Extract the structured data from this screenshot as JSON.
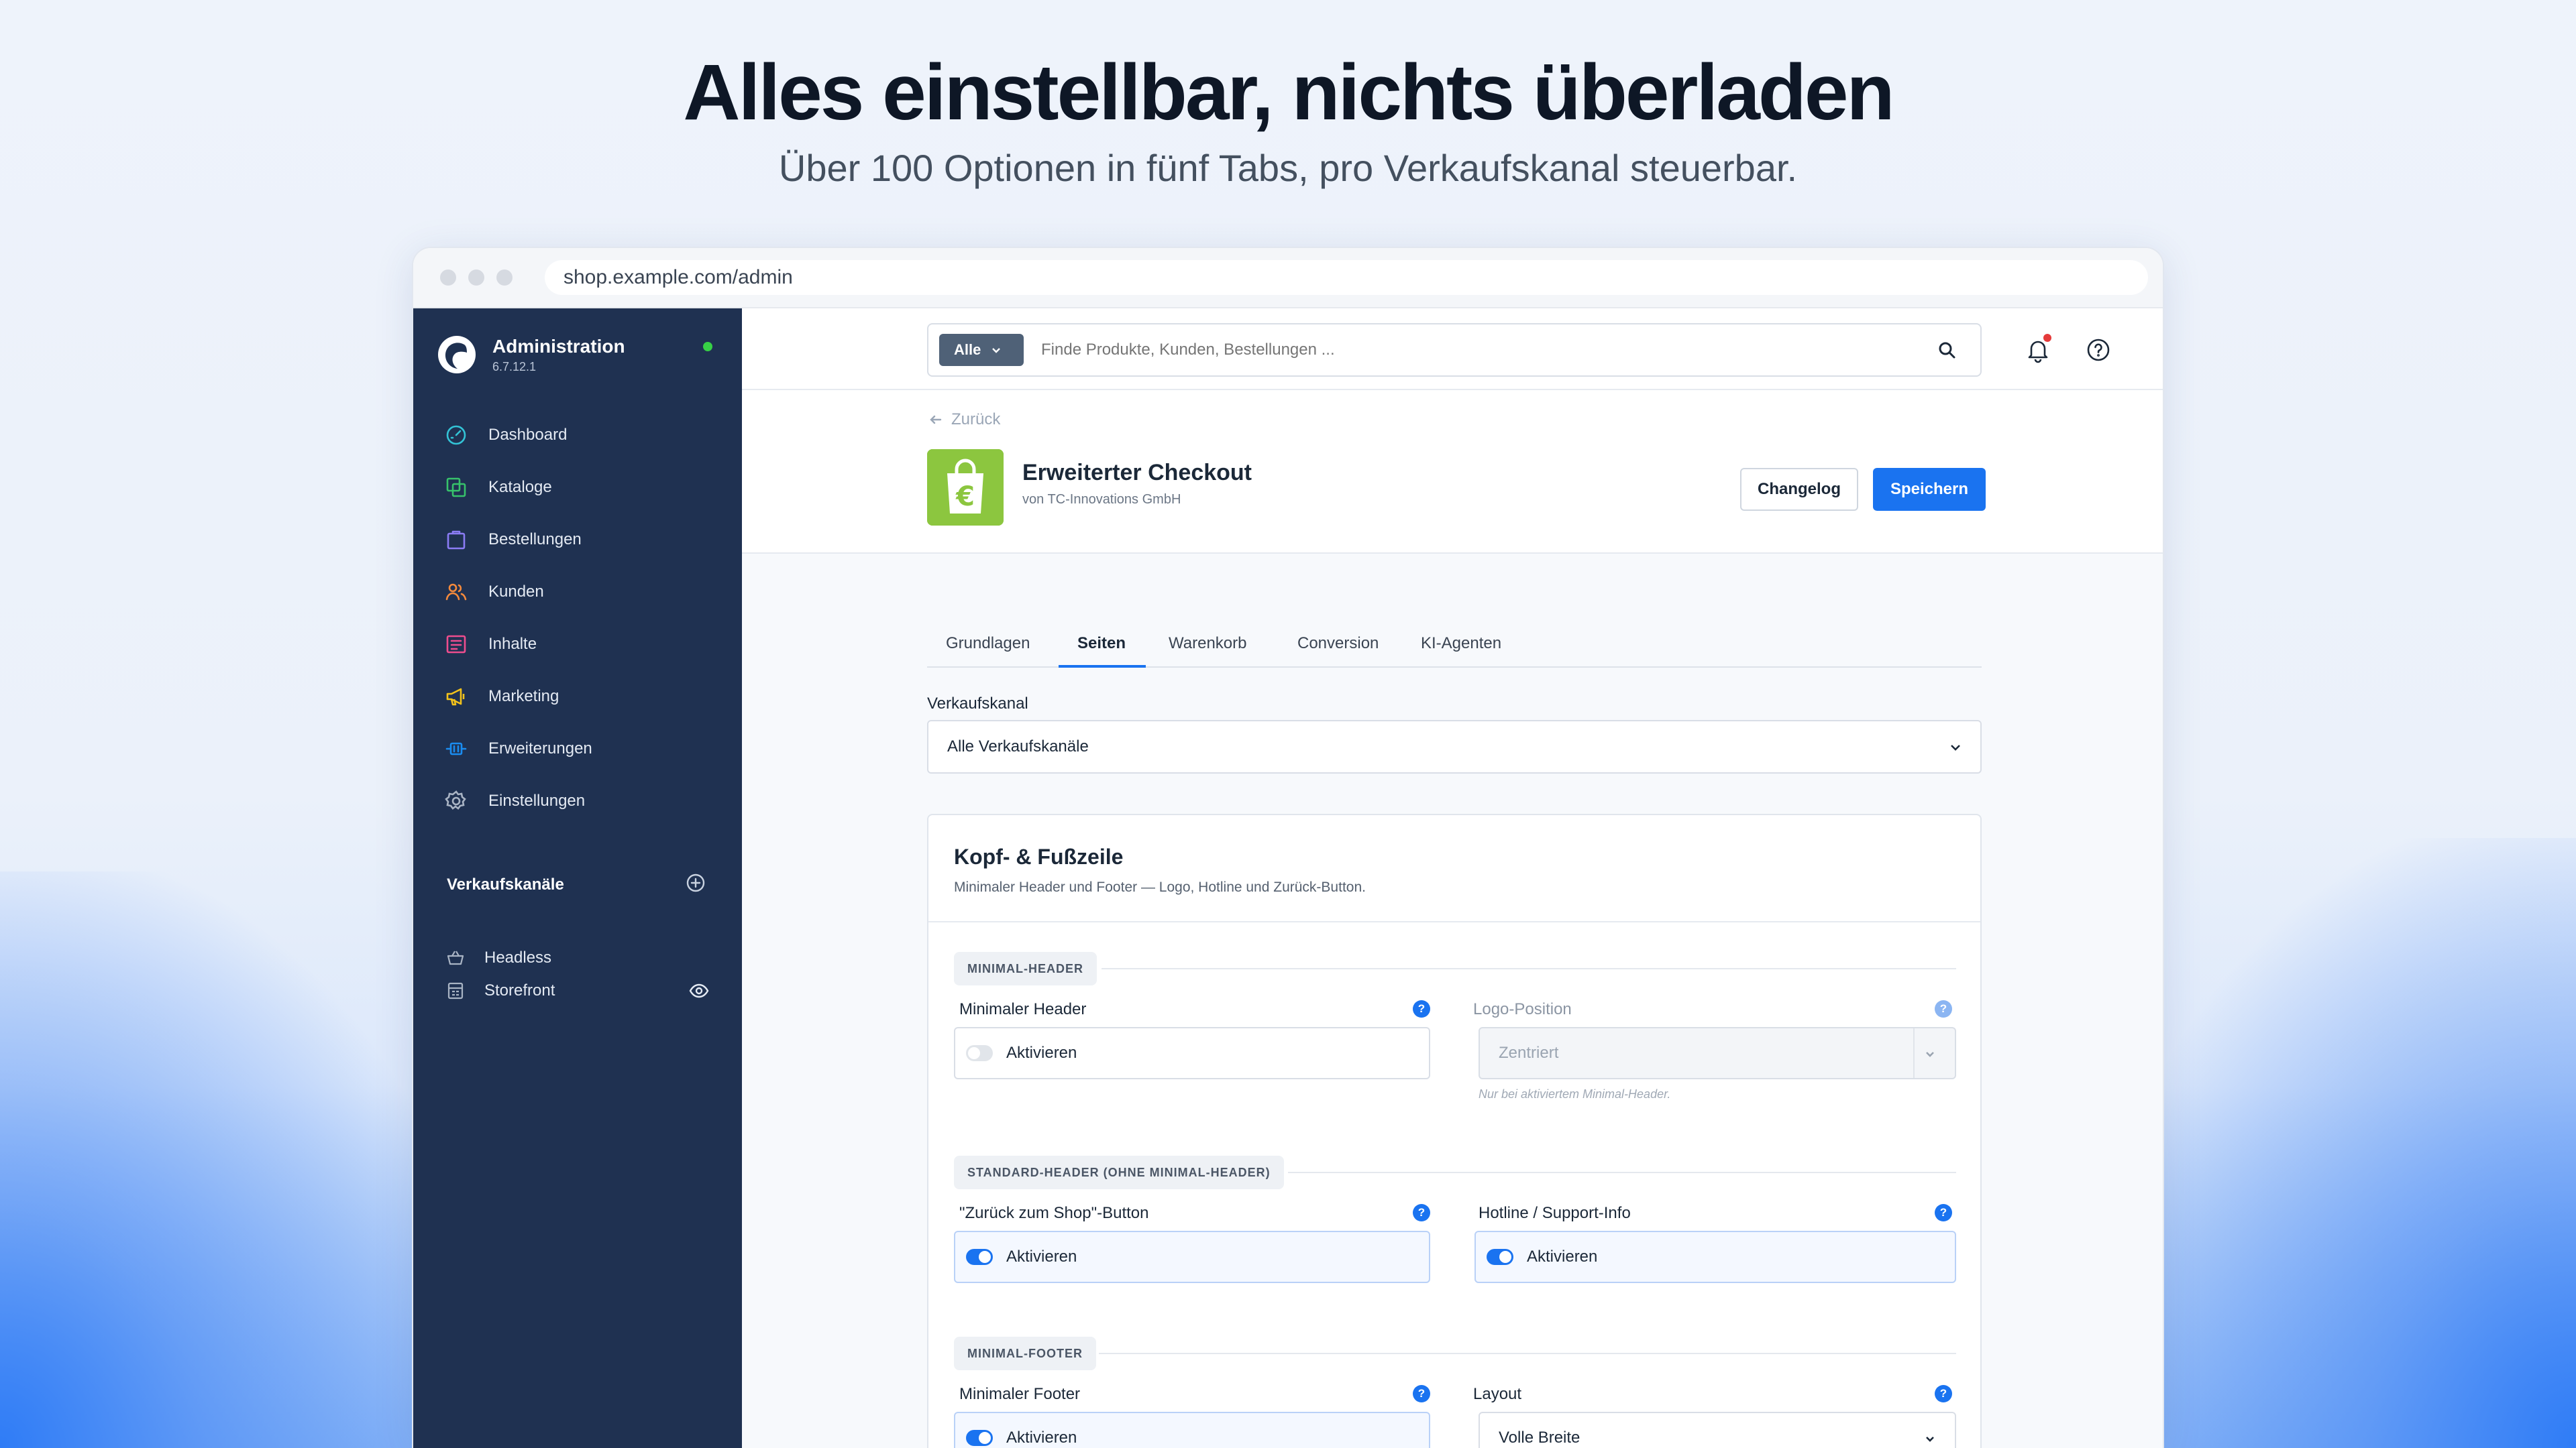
{
  "hero": {
    "headline": "Alles einstellbar, nichts überladen",
    "subheadline": "Über 100 Optionen in fünf Tabs, pro Verkaufskanal steuerbar."
  },
  "browser": {
    "url": "shop.example.com/admin"
  },
  "sidebar": {
    "brand_title": "Administration",
    "brand_version": "6.7.12.1",
    "items": [
      {
        "label": "Dashboard",
        "icon": "gauge-icon",
        "color": "#33c3d6"
      },
      {
        "label": "Kataloge",
        "icon": "copy-icon",
        "color": "#37c26b"
      },
      {
        "label": "Bestellungen",
        "icon": "shopping-bag-icon",
        "color": "#8b7cf5"
      },
      {
        "label": "Kunden",
        "icon": "users-icon",
        "color": "#f58a3c"
      },
      {
        "label": "Inhalte",
        "icon": "content-list-icon",
        "color": "#ee4d8e"
      },
      {
        "label": "Marketing",
        "icon": "megaphone-icon",
        "color": "#f2c21b"
      },
      {
        "label": "Erweiterungen",
        "icon": "plug-icon",
        "color": "#1a8cf0"
      },
      {
        "label": "Einstellungen",
        "icon": "gear-icon",
        "color": "#a9b4c4"
      }
    ],
    "channels_title": "Verkaufskanäle",
    "channels": [
      {
        "label": "Headless",
        "icon": "basket-icon"
      },
      {
        "label": "Storefront",
        "icon": "storefront-icon"
      }
    ]
  },
  "topbar": {
    "search_type": "Alle",
    "search_placeholder": "Finde Produkte, Kunden, Bestellungen ..."
  },
  "header": {
    "back_label": "Zurück",
    "plugin_title": "Erweiterter Checkout",
    "plugin_vendor": "von TC-Innovations GmbH",
    "changelog_label": "Changelog",
    "save_label": "Speichern"
  },
  "tabs": [
    {
      "label": "Grundlagen",
      "active": false
    },
    {
      "label": "Seiten",
      "active": true
    },
    {
      "label": "Warenkorb",
      "active": false
    },
    {
      "label": "Conversion",
      "active": false
    },
    {
      "label": "KI-Agenten",
      "active": false
    }
  ],
  "channel_select": {
    "label": "Verkaufskanal",
    "value": "Alle Verkaufskanäle"
  },
  "card": {
    "title": "Kopf- & Fußzeile",
    "subtitle": "Minimaler Header und Footer — Logo, Hotline und Zurück-Button.",
    "sections": {
      "minimal_header": {
        "tag": "MINIMAL-HEADER",
        "toggle_label": "Minimaler Header",
        "toggle_text": "Aktivieren",
        "toggle_on": false,
        "logo_label": "Logo-Position",
        "logo_value": "Zentriert",
        "logo_hint": "Nur bei aktiviertem Minimal-Header."
      },
      "standard_header": {
        "tag": "STANDARD-HEADER (OHNE MINIMAL-HEADER)",
        "back_label": "\"Zurück zum Shop\"-Button",
        "back_text": "Aktivieren",
        "back_on": true,
        "hotline_label": "Hotline / Support-Info",
        "hotline_text": "Aktivieren",
        "hotline_on": true
      },
      "minimal_footer": {
        "tag": "MINIMAL-FOOTER",
        "toggle_label": "Minimaler Footer",
        "toggle_text": "Aktivieren",
        "toggle_on": true,
        "layout_label": "Layout",
        "layout_value": "Volle Breite"
      }
    },
    "help_glyph": "?"
  }
}
